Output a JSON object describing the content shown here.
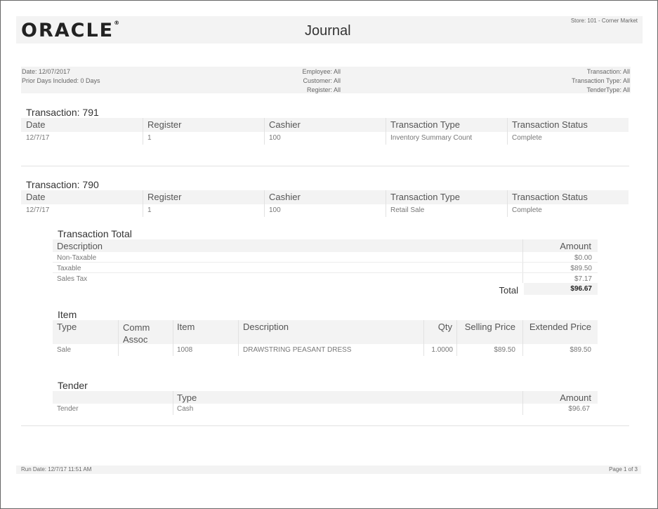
{
  "header": {
    "logo_text": "ORACLE",
    "title": "Journal",
    "store": "Store: 101 - Corner Market"
  },
  "filters": {
    "date": "Date: 12/07/2017",
    "prior_days": "Prior Days Included: 0 Days",
    "employee": "Employee: All",
    "customer": "Customer: All",
    "register": "Register: All",
    "transaction": "Transaction: All",
    "transaction_type": "Transaction Type: All",
    "tender_type": "TenderType: All"
  },
  "txn_columns": [
    "Date",
    "Register",
    "Cashier",
    "Transaction Type",
    "Transaction Status"
  ],
  "transactions": [
    {
      "title": "Transaction: 791",
      "row": [
        "12/7/17",
        "1",
        "100",
        "Inventory Summary Count",
        "Complete"
      ]
    },
    {
      "title": "Transaction: 790",
      "row": [
        "12/7/17",
        "1",
        "100",
        "Retail Sale",
        "Complete"
      ]
    }
  ],
  "totals": {
    "title": "Transaction Total",
    "col_description": "Description",
    "col_amount": "Amount",
    "rows": [
      {
        "label": "Non-Taxable",
        "amount": "$0.00"
      },
      {
        "label": "Taxable",
        "amount": "$89.50"
      },
      {
        "label": "Sales Tax",
        "amount": "$7.17"
      }
    ],
    "total_label": "Total",
    "total_amount": "$96.67"
  },
  "items": {
    "title": "Item",
    "columns": [
      "Type",
      "Comm Assoc",
      "Item",
      "Description",
      "Qty",
      "Selling Price",
      "Extended Price"
    ],
    "rows": [
      [
        "Sale",
        "",
        "1008",
        "DRAWSTRING PEASANT DRESS",
        "1.0000",
        "$89.50",
        "$89.50"
      ]
    ]
  },
  "tender": {
    "title": "Tender",
    "col_type": "Type",
    "col_amount": "Amount",
    "rows": [
      {
        "label": "Tender",
        "type": "Cash",
        "amount": "$96.67"
      }
    ]
  },
  "footer": {
    "run_date": "Run Date: 12/7/17 11:51 AM",
    "page": "Page 1 of 3"
  }
}
